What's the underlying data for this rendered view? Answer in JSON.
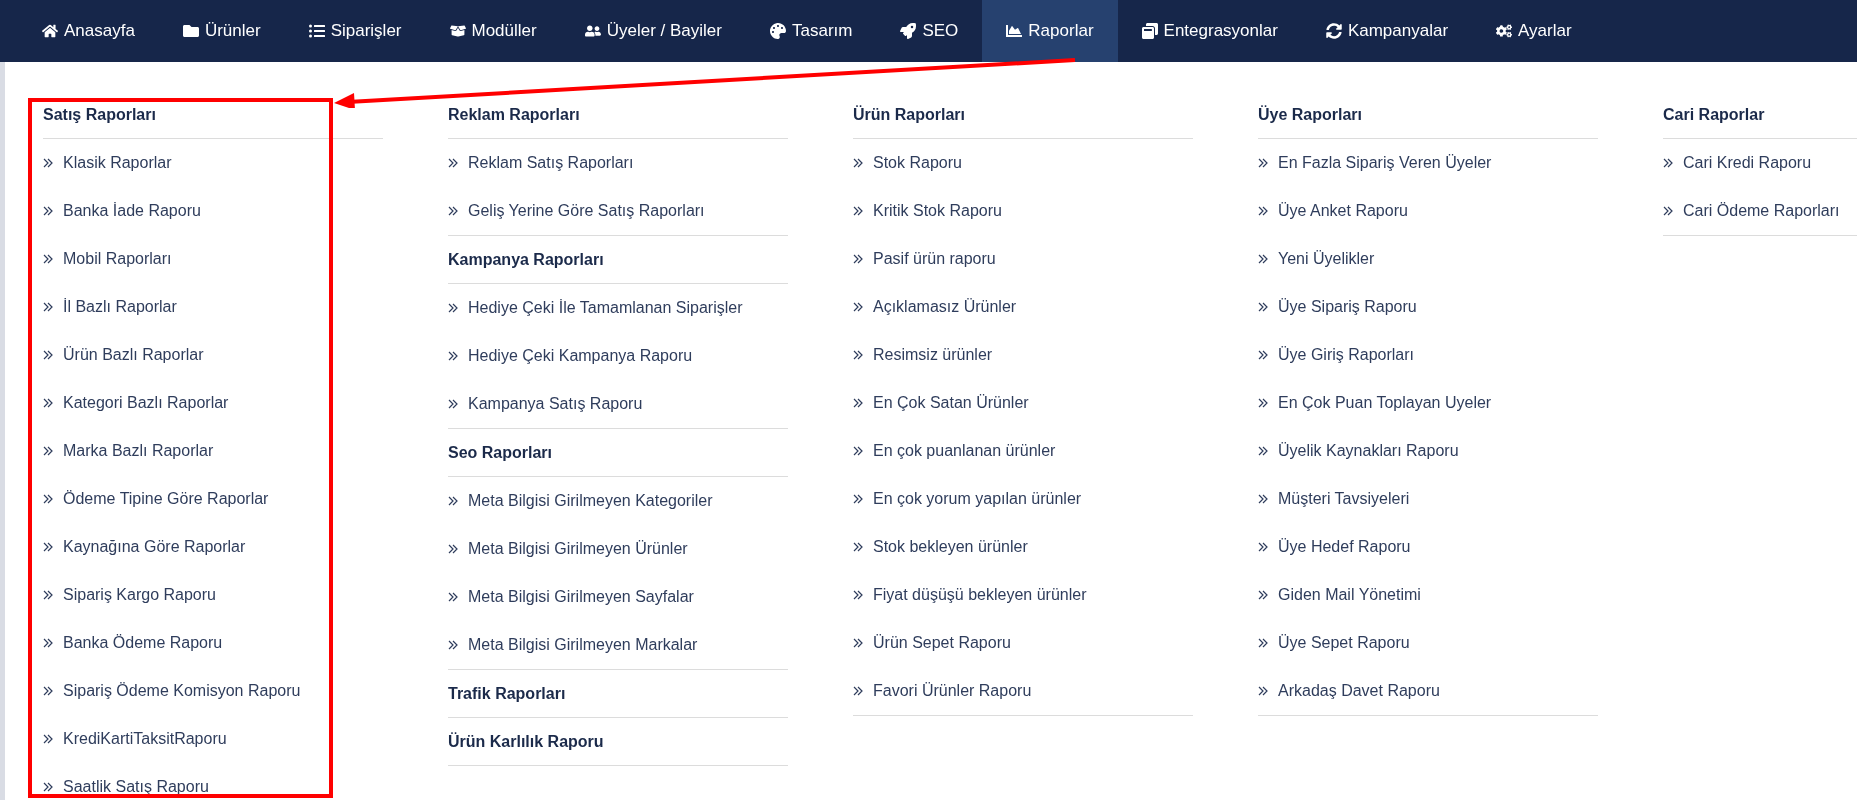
{
  "nav": [
    {
      "label": "Anasayfa",
      "selected": false
    },
    {
      "label": "Ürünler",
      "selected": false
    },
    {
      "label": "Siparişler",
      "selected": false
    },
    {
      "label": "Modüller",
      "selected": false
    },
    {
      "label": "Üyeler / Bayiler",
      "selected": false
    },
    {
      "label": "Tasarım",
      "selected": false
    },
    {
      "label": "SEO",
      "selected": false
    },
    {
      "label": "Raporlar",
      "selected": true
    },
    {
      "label": "Entegrasyonlar",
      "selected": false
    },
    {
      "label": "Kampanyalar",
      "selected": false
    },
    {
      "label": "Ayarlar",
      "selected": false
    }
  ],
  "columns": [
    {
      "sections": [
        {
          "heading": "Satış Raporları",
          "items": [
            "Klasik Raporlar",
            "Banka İade Raporu",
            "Mobil Raporları",
            "İl Bazlı Raporlar",
            "Ürün Bazlı Raporlar",
            "Kategori Bazlı Raporlar",
            "Marka Bazlı Raporlar",
            "Ödeme Tipine Göre Raporlar",
            "Kaynağına Göre Raporlar",
            "Sipariş Kargo Raporu",
            "Banka Ödeme Raporu",
            "Sipariş Ödeme Komisyon Raporu",
            "KrediKartiTaksitRaporu",
            "Saatlik Satış Raporu"
          ]
        }
      ]
    },
    {
      "sections": [
        {
          "heading": "Reklam Raporları",
          "items": [
            "Reklam Satış Raporları",
            "Geliş Yerine Göre Satış Raporları"
          ]
        },
        {
          "heading": "Kampanya Raporları",
          "items": [
            "Hediye Çeki İle Tamamlanan Siparişler",
            "Hediye Çeki Kampanya Raporu",
            "Kampanya Satış Raporu"
          ]
        },
        {
          "heading": "Seo Raporları",
          "items": [
            "Meta Bilgisi Girilmeyen Kategoriler",
            "Meta Bilgisi Girilmeyen Ürünler",
            "Meta Bilgisi Girilmeyen Sayfalar",
            "Meta Bilgisi Girilmeyen Markalar"
          ]
        },
        {
          "heading": "Trafik Raporları"
        },
        {
          "heading": "Ürün Karlılık Raporu"
        }
      ]
    },
    {
      "sections": [
        {
          "heading": "Ürün Raporları",
          "items": [
            "Stok Raporu",
            "Kritik Stok Raporu",
            "Pasif ürün raporu",
            "Açıklamasız Ürünler",
            "Resimsiz ürünler",
            "En Çok Satan Ürünler",
            "En çok puanlanan ürünler",
            "En çok yorum yapılan ürünler",
            "Stok bekleyen ürünler",
            "Fiyat düşüşü bekleyen ürünler",
            "Ürün Sepet Raporu",
            "Favori Ürünler Raporu"
          ]
        }
      ]
    },
    {
      "sections": [
        {
          "heading": "Üye Raporları",
          "items": [
            "En Fazla Sipariş Veren Üyeler",
            "Üye Anket Raporu",
            "Yeni Üyelikler",
            "Üye Sipariş Raporu",
            "Üye Giriş Raporları",
            "En Çok Puan Toplayan Uyeler",
            "Üyelik Kaynakları Raporu",
            "Müşteri Tavsiyeleri",
            "Üye Hedef Raporu",
            "Giden Mail Yönetimi",
            "Üye Sepet Raporu",
            "Arkadaş Davet Raporu"
          ]
        }
      ]
    },
    {
      "sections": [
        {
          "heading": "Cari Raporlar",
          "items": [
            "Cari Kredi Raporu",
            "Cari Ödeme Raporları"
          ]
        }
      ]
    }
  ]
}
